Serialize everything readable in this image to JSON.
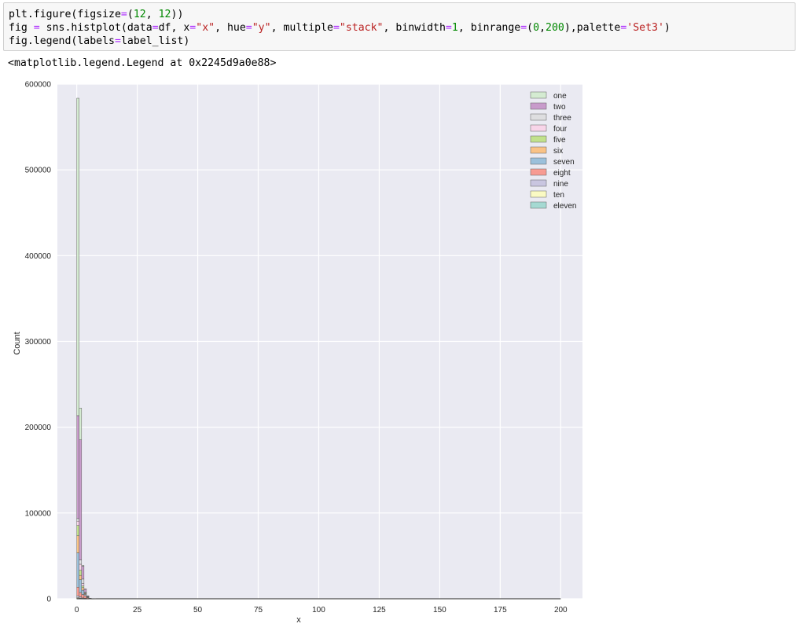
{
  "code_cell": {
    "lines": [
      [
        {
          "t": "plt.figure(figsize"
        },
        {
          "t": "=",
          "c": "op"
        },
        {
          "t": "("
        },
        {
          "t": "12",
          "c": "num"
        },
        {
          "t": ", "
        },
        {
          "t": "12",
          "c": "num"
        },
        {
          "t": "))"
        }
      ],
      [
        {
          "t": "fig "
        },
        {
          "t": "=",
          "c": "op"
        },
        {
          "t": " sns.histplot(data"
        },
        {
          "t": "=",
          "c": "op"
        },
        {
          "t": "df, x"
        },
        {
          "t": "=",
          "c": "op"
        },
        {
          "t": "\"x\"",
          "c": "str"
        },
        {
          "t": ", hue"
        },
        {
          "t": "=",
          "c": "op"
        },
        {
          "t": "\"y\"",
          "c": "str"
        },
        {
          "t": ", multiple"
        },
        {
          "t": "=",
          "c": "op"
        },
        {
          "t": "\"stack\"",
          "c": "str"
        },
        {
          "t": ", binwidth"
        },
        {
          "t": "=",
          "c": "op"
        },
        {
          "t": "1",
          "c": "num"
        },
        {
          "t": ", binrange"
        },
        {
          "t": "=",
          "c": "op"
        },
        {
          "t": "("
        },
        {
          "t": "0",
          "c": "num"
        },
        {
          "t": ","
        },
        {
          "t": "200",
          "c": "num"
        },
        {
          "t": "),palette"
        },
        {
          "t": "=",
          "c": "op"
        },
        {
          "t": "'Set3'",
          "c": "str"
        },
        {
          "t": ")"
        }
      ],
      [
        {
          "t": "fig.legend(labels"
        },
        {
          "t": "=",
          "c": "op"
        },
        {
          "t": "label_list)"
        }
      ]
    ]
  },
  "output_text": "<matplotlib.legend.Legend at 0x2245d9a0e88>",
  "chart_data": {
    "type": "bar",
    "xlabel": "x",
    "ylabel": "Count",
    "xlim": [
      -8,
      209
    ],
    "ylim": [
      0,
      600000
    ],
    "xticks": [
      0,
      25,
      50,
      75,
      100,
      125,
      150,
      175,
      200
    ],
    "yticks": [
      0,
      100000,
      200000,
      300000,
      400000,
      500000,
      600000
    ],
    "xtick_labels": [
      "0",
      "25",
      "50",
      "75",
      "100",
      "125",
      "150",
      "175",
      "200"
    ],
    "ytick_labels": [
      "0",
      "100000",
      "200000",
      "300000",
      "400000",
      "500000",
      "600000"
    ],
    "grid": true,
    "legend_position": "top-right",
    "bins": [
      [
        0,
        1
      ],
      [
        1,
        2
      ],
      [
        2,
        3
      ],
      [
        3,
        4
      ],
      [
        4,
        5
      ],
      [
        5,
        6
      ],
      [
        6,
        7
      ],
      [
        7,
        8
      ]
    ],
    "series": [
      {
        "name": "one",
        "color": "#8dd3c7",
        "values": [
          500,
          300,
          100,
          50,
          0,
          0,
          0,
          0
        ]
      },
      {
        "name": "two",
        "color": "#ffffb3",
        "values": [
          1000,
          500,
          300,
          200,
          100,
          0,
          0,
          0
        ]
      },
      {
        "name": "three",
        "color": "#bebada",
        "values": [
          2000,
          1500,
          600,
          300,
          200,
          0,
          0,
          0
        ]
      },
      {
        "name": "four",
        "color": "#fb8072",
        "values": [
          10000,
          5000,
          4000,
          3000,
          1000,
          300,
          0,
          0
        ]
      },
      {
        "name": "five",
        "color": "#80b1d3",
        "values": [
          40000,
          15000,
          5000,
          1500,
          500,
          0,
          0,
          0
        ]
      },
      {
        "name": "six",
        "color": "#fdb462",
        "values": [
          20000,
          5000,
          3000,
          1000,
          200,
          0,
          0,
          0
        ]
      },
      {
        "name": "seven",
        "color": "#b3de69",
        "values": [
          12000,
          6000,
          2000,
          500,
          100,
          0,
          0,
          0
        ]
      },
      {
        "name": "eight",
        "color": "#fccde5",
        "values": [
          5000,
          7000,
          3000,
          500,
          200,
          0,
          0,
          0
        ]
      },
      {
        "name": "nine",
        "color": "#d9d9d9",
        "values": [
          3000,
          5000,
          5000,
          1000,
          200,
          0,
          0,
          0
        ]
      },
      {
        "name": "ten",
        "color": "#bc80bd",
        "values": [
          120000,
          140000,
          15000,
          3000,
          800,
          200,
          100,
          0
        ]
      },
      {
        "name": "eleven",
        "color": "#ccebc5",
        "values": [
          370000,
          37000,
          1000,
          400,
          200,
          100,
          0,
          0
        ]
      }
    ],
    "legend_labels": [
      "one",
      "two",
      "three",
      "four",
      "five",
      "six",
      "seven",
      "eight",
      "nine",
      "ten",
      "eleven"
    ],
    "legend_colors": [
      "#ccebc5",
      "#bc80bd",
      "#d9d9d9",
      "#fccde5",
      "#b3de69",
      "#fdb462",
      "#80b1d3",
      "#fb8072",
      "#bebada",
      "#ffffb3",
      "#8dd3c7"
    ]
  },
  "colors": {
    "plot_background": "#eaeaf2",
    "grid": "#ffffff",
    "bar_edge": "#5f5f5f"
  }
}
